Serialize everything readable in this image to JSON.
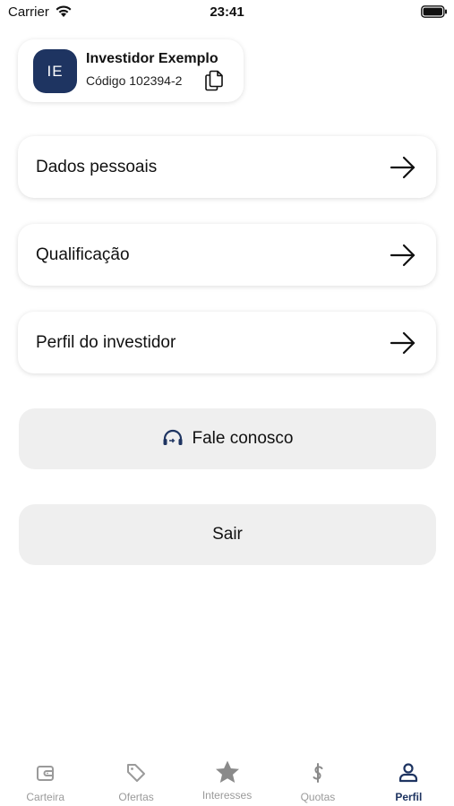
{
  "status_bar": {
    "carrier": "Carrier",
    "time": "23:41"
  },
  "profile": {
    "initials": "IE",
    "name": "Investidor Exemplo",
    "code": "Código 102394-2",
    "avatar_color": "#1e3461"
  },
  "menu": {
    "items": [
      {
        "label": "Dados pessoais",
        "icon": "arrow-right-icon"
      },
      {
        "label": "Qualificação",
        "icon": "arrow-right-icon"
      },
      {
        "label": "Perfil do investidor",
        "icon": "arrow-right-icon"
      }
    ]
  },
  "actions": {
    "contact_label": "Fale conosco",
    "contact_icon": "headset-icon",
    "logout_label": "Sair"
  },
  "tab_bar": {
    "active_color": "#1e3461",
    "inactive_color": "#9a9a9a",
    "tabs": [
      {
        "label": "Carteira",
        "icon": "wallet-icon",
        "active": false
      },
      {
        "label": "Ofertas",
        "icon": "tag-icon",
        "active": false
      },
      {
        "label": "Interesses",
        "icon": "star-icon",
        "active": false
      },
      {
        "label": "Quotas",
        "icon": "dollar-icon",
        "active": false
      },
      {
        "label": "Perfil",
        "icon": "person-icon",
        "active": true
      }
    ]
  }
}
